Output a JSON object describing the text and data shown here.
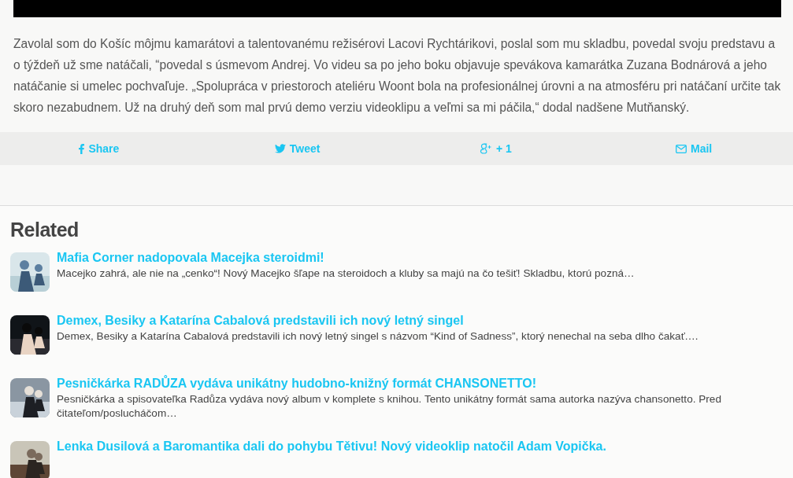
{
  "article": {
    "paragraph": "Zavolal som do Košíc môjmu kamarátovi a talentovanému režisérovi Lacovi Rychtárikovi, poslal som mu skladbu, povedal svoju predstavu a o týždeň už sme natáčali, “povedal s úsmevom Andrej. Vo videu sa po jeho boku objavuje spevákova kamarátka Zuzana Bodnárová a jeho natáčanie si umelec pochvaľuje. „Spolupráca v priestoroch ateliéru Woont bola na profesionálnej úrovni a na atmosféru pri natáčaní určite tak skoro nezabudnem. Už na druhý deň som mal prvú demo verziu videoklipu a veľmi sa mi páčila,“ dodal nadšene Mutňanský."
  },
  "share_bar": [
    {
      "kind": "facebook",
      "label": "Share"
    },
    {
      "kind": "twitter",
      "label": "Tweet"
    },
    {
      "kind": "gplus",
      "label": "+ 1"
    },
    {
      "kind": "mail",
      "label": "Mail"
    }
  ],
  "related": {
    "heading": "Related",
    "items": [
      {
        "title": "Mafia Corner nadopovala Macejka steroidmi!",
        "excerpt": "Macejko zahrá, ale nie na „cenko“! Nový Macejko šľape na steroidoch a kluby sa majú na čo tešiť! Skladbu, ktorú pozná…"
      },
      {
        "title": "Demex, Besiky a Katarína Cabalová predstavili ich nový letný singel",
        "excerpt": "Demex, Besiky a Katarína Cabalová predstavili ich nový letný singel s názvom “Kind of Sadness”, ktorý nenechal na seba dlho čakať.…"
      },
      {
        "title": "Pesničkárka RADŮZA vydáva unikátny hudobno-knižný formát CHANSONETTO!",
        "excerpt": "Pesničkárka a spisovateľka Radůza vydáva nový album v komplete s knihou. Tento unikátny formát sama autorka nazýva chansonetto. Pred čitateľom/poslucháčom…"
      },
      {
        "title": "Lenka Dusilová a Baromantika dali do pohybu Tětivu! Nový videoklip natočil Adam Vopička."
      }
    ]
  }
}
